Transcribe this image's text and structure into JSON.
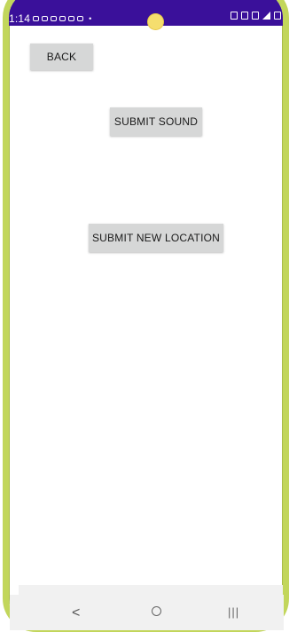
{
  "status_bar": {
    "time": "1:14",
    "dot": "•",
    "background_color": "#3a109a"
  },
  "frame": {
    "color": "#c2d65b"
  },
  "buttons": {
    "back": "BACK",
    "submit_sound": "SUBMIT SOUND",
    "submit_new_location": "SUBMIT NEW LOCATION"
  },
  "nav_bar": {
    "back_glyph": "<",
    "recents_glyph": "|||"
  }
}
